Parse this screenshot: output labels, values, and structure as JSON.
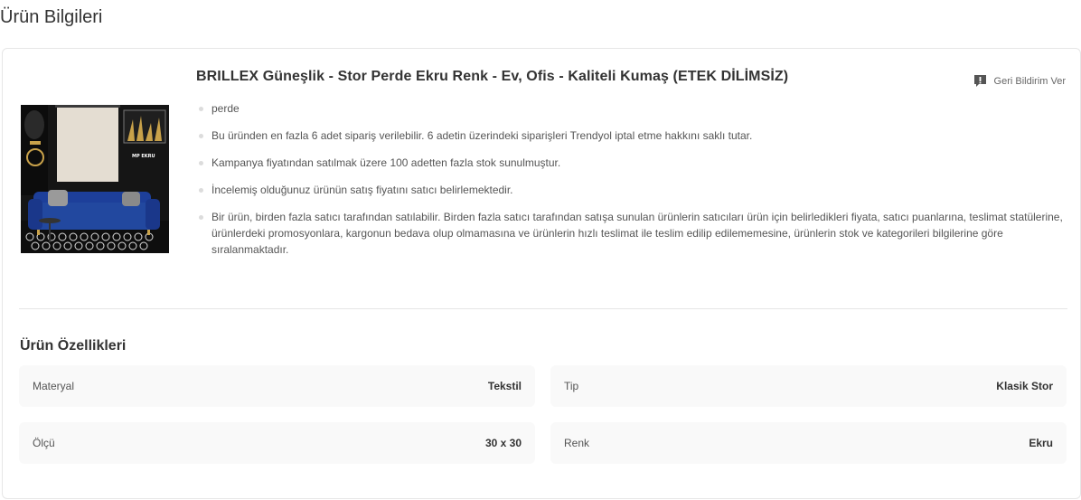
{
  "page": {
    "section_title": "Ürün Bilgileri"
  },
  "product": {
    "title": "BRILLEX Güneşlik - Stor Perde Ekru Renk - Ev, Ofis - Kaliteli Kumaş (ETEK DİLİMSİZ)",
    "image_caption": "MP EKRU",
    "feedback_label": "Geri Bildirim Ver",
    "info": [
      "perde",
      "Bu üründen en fazla 6 adet sipariş verilebilir. 6 adetin üzerindeki siparişleri Trendyol iptal etme hakkını saklı tutar.",
      "Kampanya fiyatından satılmak üzere 100 adetten fazla stok sunulmuştur.",
      "İncelemiş olduğunuz ürünün satış fiyatını satıcı belirlemektedir.",
      "Bir ürün, birden fazla satıcı tarafından satılabilir. Birden fazla satıcı tarafından satışa sunulan ürünlerin satıcıları ürün için belirledikleri fiyata, satıcı puanlarına, teslimat statülerine, ürünlerdeki promosyonlara, kargonun bedava olup olmamasına ve ürünlerin hızlı teslimat ile teslim edilip edilememesine, ürünlerin stok ve kategorileri bilgilerine göre sıralanmaktadır."
    ]
  },
  "properties": {
    "title": "Ürün Özellikleri",
    "items": [
      {
        "key": "Materyal",
        "value": "Tekstil"
      },
      {
        "key": "Tip",
        "value": "Klasik Stor"
      },
      {
        "key": "Ölçü",
        "value": "30 x 30"
      },
      {
        "key": "Renk",
        "value": "Ekru"
      }
    ]
  },
  "colors": {
    "sofa": "#1d3f9a",
    "blind": "#e4ddd2",
    "wall": "#151515"
  }
}
